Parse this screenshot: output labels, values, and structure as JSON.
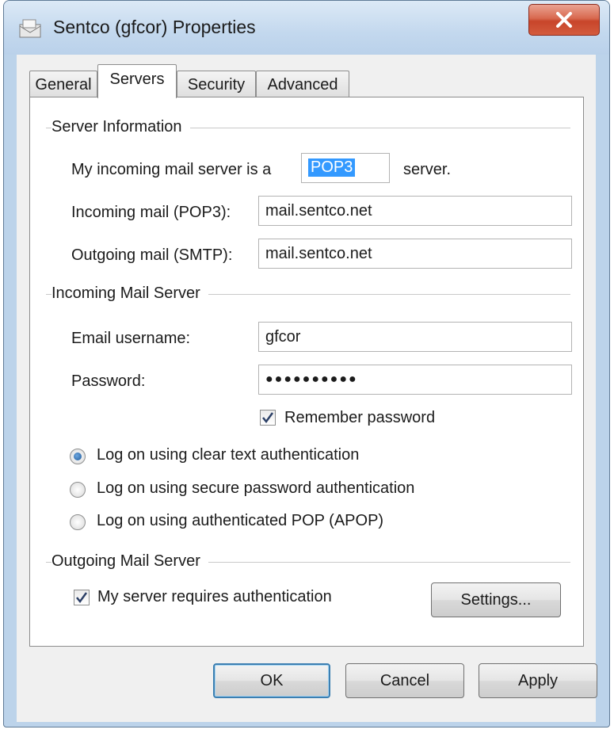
{
  "window": {
    "title": "Sentco (gfcor) Properties"
  },
  "tabs": [
    {
      "label": "General",
      "active": false
    },
    {
      "label": "Servers",
      "active": true
    },
    {
      "label": "Security",
      "active": false
    },
    {
      "label": "Advanced",
      "active": false
    }
  ],
  "server_information": {
    "heading": "Server Information",
    "incoming_type_prefix": "My incoming mail server is a",
    "incoming_type_value": "POP3",
    "incoming_type_suffix": "server.",
    "incoming_label": "Incoming mail (POP3):",
    "incoming_value": "mail.sentco.net",
    "outgoing_label": "Outgoing mail (SMTP):",
    "outgoing_value": "mail.sentco.net"
  },
  "incoming_mail_server": {
    "heading": "Incoming Mail Server",
    "username_label": "Email username:",
    "username_value": "gfcor",
    "password_label": "Password:",
    "password_value": "●●●●●●●●●●",
    "remember_label": "Remember password",
    "remember_checked": true,
    "auth_options": [
      {
        "label": "Log on using clear text authentication",
        "selected": true
      },
      {
        "label": "Log on using secure password authentication",
        "selected": false
      },
      {
        "label": "Log on using authenticated POP (APOP)",
        "selected": false
      }
    ]
  },
  "outgoing_mail_server": {
    "heading": "Outgoing Mail Server",
    "requires_auth_label": "My server requires authentication",
    "requires_auth_checked": true,
    "settings_button": "Settings..."
  },
  "footer": {
    "ok": "OK",
    "cancel": "Cancel",
    "apply": "Apply"
  },
  "colors": {
    "selection": "#3399ff",
    "close_button": "#c8452a",
    "title_bar": "#c3d8ee"
  }
}
